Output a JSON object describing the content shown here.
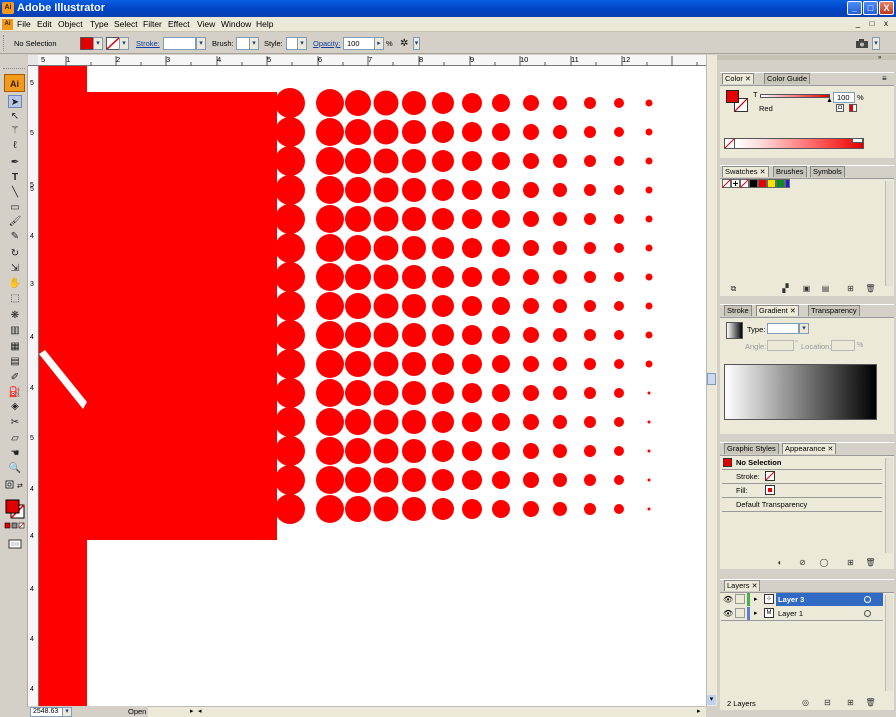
{
  "window": {
    "title": "Adobe Illustrator",
    "app_icon": "Ai",
    "controls": [
      "_",
      "□",
      "X"
    ],
    "doc_controls": [
      "_",
      "□",
      "x"
    ]
  },
  "menu": [
    "File",
    "Edit",
    "Object",
    "Type",
    "Select",
    "Filter",
    "Effect",
    "View",
    "Window",
    "Help"
  ],
  "control_bar": {
    "selection_label": "No Selection",
    "stroke_label": "Stroke:",
    "brush_label": "Brush:",
    "style_label": "Style:",
    "opacity_label": "Opacity:",
    "opacity_value": "100",
    "opacity_unit": "%",
    "fill_color": "#e00000"
  },
  "ruler_top": [
    "5",
    "1",
    "2",
    "3",
    "4",
    "5",
    "6",
    "7",
    "8",
    "9",
    "10",
    "11",
    "12"
  ],
  "ruler_left": [
    "5",
    "5",
    "5",
    "5",
    "4",
    "3",
    "4",
    "4",
    "5",
    "4",
    "4",
    "4",
    "4",
    "4"
  ],
  "toolbox": {
    "logo": "Ai",
    "tools": [
      "selection-tool",
      "direct-selection-tool",
      "magic-wand-tool",
      "lasso-tool",
      "pen-tool",
      "type-tool",
      "line-tool",
      "rectangle-tool",
      "paintbrush-tool",
      "pencil-tool",
      "rotate-tool",
      "scale-tool",
      "warp-tool",
      "free-transform-tool",
      "symbol-sprayer-tool",
      "column-graph-tool",
      "mesh-tool",
      "gradient-tool",
      "eyedropper-tool",
      "live-paint-bucket-tool",
      "live-paint-selection-tool",
      "slice-tool",
      "eraser-tool",
      "hand-tool",
      "zoom-tool"
    ]
  },
  "canvas": {
    "background": "#ffffff",
    "art_color": "#ff0000"
  },
  "status": {
    "zoom": "2548.63",
    "text": "Open"
  },
  "panels": {
    "color": {
      "tabs": [
        "Color",
        "Color Guide"
      ],
      "channel": "T",
      "value": "100",
      "unit": "%",
      "name": "Red",
      "color": "#e60000"
    },
    "swatches": {
      "tabs": [
        "Swatches",
        "Brushes",
        "Symbols"
      ]
    },
    "gradient": {
      "tabs": [
        "Stroke",
        "Gradient",
        "Transparency"
      ],
      "type_label": "Type:",
      "angle_label": "Angle:",
      "location_label": "Location:",
      "angle_unit": "°",
      "location_unit": "%"
    },
    "appearance": {
      "tabs": [
        "Graphic Styles",
        "Appearance"
      ],
      "selection": "No Selection",
      "stroke_label": "Stroke:",
      "fill_label": "Fill:",
      "transparency": "Default Transparency"
    },
    "layers": {
      "tabs": [
        "Layers"
      ],
      "items": [
        {
          "name": "Layer 3",
          "selected": true
        },
        {
          "name": "Layer 1",
          "selected": false
        }
      ],
      "count": "2 Layers"
    }
  }
}
